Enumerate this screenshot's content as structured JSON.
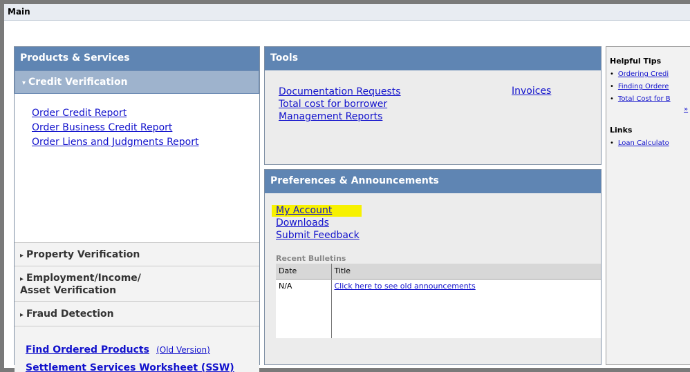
{
  "top_bar": {
    "title": "Main"
  },
  "products": {
    "title": "Products & Services",
    "credit_verification": {
      "label": "Credit Verification",
      "links": [
        "Order Credit Report",
        "Order Business Credit Report",
        "Order Liens and Judgments Report"
      ]
    },
    "property_verification": "Property Verification",
    "employment_line1": "Employment/Income/",
    "employment_line2": "Asset Verification",
    "fraud_detection": "Fraud Detection",
    "find_ordered": "Find Ordered Products",
    "old_version": "(Old Version)",
    "ssw": "Settlement Services Worksheet (SSW)"
  },
  "tools": {
    "title": "Tools",
    "links": [
      "Documentation Requests",
      "Total cost for borrower",
      "Management Reports"
    ],
    "invoices": "Invoices"
  },
  "preferences": {
    "title": "Preferences & Announcements",
    "links": [
      "My Account",
      "Downloads",
      "Submit Feedback"
    ],
    "highlight_color": "#f7f100",
    "recent_bulletins": "Recent Bulletins",
    "columns": [
      "Date",
      "Title"
    ],
    "rows": [
      {
        "date": "N/A",
        "title": "Click here to see old announcements"
      }
    ]
  },
  "right_panel": {
    "helpful_tips_title": "Helpful Tips",
    "tips": [
      "Ordering Credi",
      "Finding Ordere",
      "Total Cost for B"
    ],
    "more": "»",
    "links_title": "Links",
    "links": [
      "Loan Calculato"
    ]
  },
  "colors": {
    "header_blue": "#5f85b3",
    "link_blue": "#1111cc"
  }
}
